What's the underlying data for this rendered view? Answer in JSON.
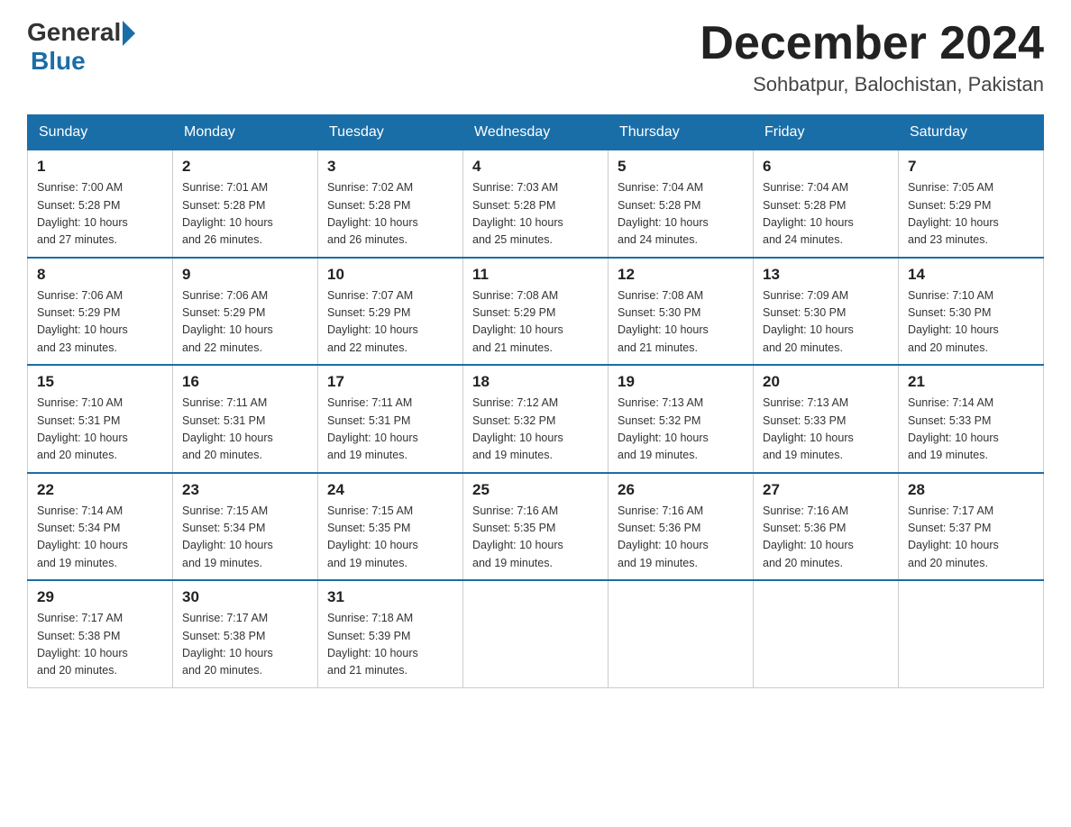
{
  "header": {
    "logo_general": "General",
    "logo_blue": "Blue",
    "title": "December 2024",
    "location": "Sohbatpur, Balochistan, Pakistan"
  },
  "weekdays": [
    "Sunday",
    "Monday",
    "Tuesday",
    "Wednesday",
    "Thursday",
    "Friday",
    "Saturday"
  ],
  "weeks": [
    [
      {
        "day": "1",
        "sunrise": "7:00 AM",
        "sunset": "5:28 PM",
        "daylight": "10 hours and 27 minutes."
      },
      {
        "day": "2",
        "sunrise": "7:01 AM",
        "sunset": "5:28 PM",
        "daylight": "10 hours and 26 minutes."
      },
      {
        "day": "3",
        "sunrise": "7:02 AM",
        "sunset": "5:28 PM",
        "daylight": "10 hours and 26 minutes."
      },
      {
        "day": "4",
        "sunrise": "7:03 AM",
        "sunset": "5:28 PM",
        "daylight": "10 hours and 25 minutes."
      },
      {
        "day": "5",
        "sunrise": "7:04 AM",
        "sunset": "5:28 PM",
        "daylight": "10 hours and 24 minutes."
      },
      {
        "day": "6",
        "sunrise": "7:04 AM",
        "sunset": "5:28 PM",
        "daylight": "10 hours and 24 minutes."
      },
      {
        "day": "7",
        "sunrise": "7:05 AM",
        "sunset": "5:29 PM",
        "daylight": "10 hours and 23 minutes."
      }
    ],
    [
      {
        "day": "8",
        "sunrise": "7:06 AM",
        "sunset": "5:29 PM",
        "daylight": "10 hours and 23 minutes."
      },
      {
        "day": "9",
        "sunrise": "7:06 AM",
        "sunset": "5:29 PM",
        "daylight": "10 hours and 22 minutes."
      },
      {
        "day": "10",
        "sunrise": "7:07 AM",
        "sunset": "5:29 PM",
        "daylight": "10 hours and 22 minutes."
      },
      {
        "day": "11",
        "sunrise": "7:08 AM",
        "sunset": "5:29 PM",
        "daylight": "10 hours and 21 minutes."
      },
      {
        "day": "12",
        "sunrise": "7:08 AM",
        "sunset": "5:30 PM",
        "daylight": "10 hours and 21 minutes."
      },
      {
        "day": "13",
        "sunrise": "7:09 AM",
        "sunset": "5:30 PM",
        "daylight": "10 hours and 20 minutes."
      },
      {
        "day": "14",
        "sunrise": "7:10 AM",
        "sunset": "5:30 PM",
        "daylight": "10 hours and 20 minutes."
      }
    ],
    [
      {
        "day": "15",
        "sunrise": "7:10 AM",
        "sunset": "5:31 PM",
        "daylight": "10 hours and 20 minutes."
      },
      {
        "day": "16",
        "sunrise": "7:11 AM",
        "sunset": "5:31 PM",
        "daylight": "10 hours and 20 minutes."
      },
      {
        "day": "17",
        "sunrise": "7:11 AM",
        "sunset": "5:31 PM",
        "daylight": "10 hours and 19 minutes."
      },
      {
        "day": "18",
        "sunrise": "7:12 AM",
        "sunset": "5:32 PM",
        "daylight": "10 hours and 19 minutes."
      },
      {
        "day": "19",
        "sunrise": "7:13 AM",
        "sunset": "5:32 PM",
        "daylight": "10 hours and 19 minutes."
      },
      {
        "day": "20",
        "sunrise": "7:13 AM",
        "sunset": "5:33 PM",
        "daylight": "10 hours and 19 minutes."
      },
      {
        "day": "21",
        "sunrise": "7:14 AM",
        "sunset": "5:33 PM",
        "daylight": "10 hours and 19 minutes."
      }
    ],
    [
      {
        "day": "22",
        "sunrise": "7:14 AM",
        "sunset": "5:34 PM",
        "daylight": "10 hours and 19 minutes."
      },
      {
        "day": "23",
        "sunrise": "7:15 AM",
        "sunset": "5:34 PM",
        "daylight": "10 hours and 19 minutes."
      },
      {
        "day": "24",
        "sunrise": "7:15 AM",
        "sunset": "5:35 PM",
        "daylight": "10 hours and 19 minutes."
      },
      {
        "day": "25",
        "sunrise": "7:16 AM",
        "sunset": "5:35 PM",
        "daylight": "10 hours and 19 minutes."
      },
      {
        "day": "26",
        "sunrise": "7:16 AM",
        "sunset": "5:36 PM",
        "daylight": "10 hours and 19 minutes."
      },
      {
        "day": "27",
        "sunrise": "7:16 AM",
        "sunset": "5:36 PM",
        "daylight": "10 hours and 20 minutes."
      },
      {
        "day": "28",
        "sunrise": "7:17 AM",
        "sunset": "5:37 PM",
        "daylight": "10 hours and 20 minutes."
      }
    ],
    [
      {
        "day": "29",
        "sunrise": "7:17 AM",
        "sunset": "5:38 PM",
        "daylight": "10 hours and 20 minutes."
      },
      {
        "day": "30",
        "sunrise": "7:17 AM",
        "sunset": "5:38 PM",
        "daylight": "10 hours and 20 minutes."
      },
      {
        "day": "31",
        "sunrise": "7:18 AM",
        "sunset": "5:39 PM",
        "daylight": "10 hours and 21 minutes."
      },
      null,
      null,
      null,
      null
    ]
  ]
}
